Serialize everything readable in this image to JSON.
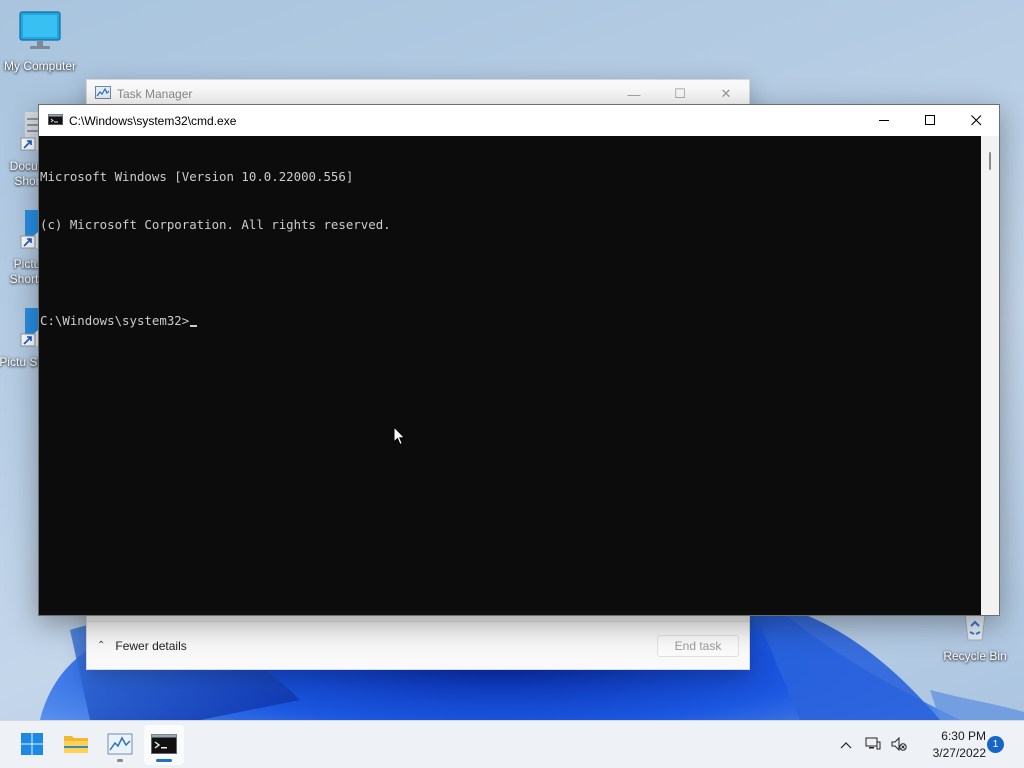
{
  "desktop": {
    "icons": [
      {
        "label": "My Computer",
        "icon": "monitor-icon"
      },
      {
        "label": "Docun Shor",
        "icon": "documents-shortcut-icon"
      },
      {
        "label": "Pictu Shortc",
        "icon": "pictures-shortcut-icon"
      },
      {
        "label": "Pictu Shor",
        "icon": "pictures-shortcut-icon"
      },
      {
        "label": "Recycle Bin",
        "icon": "recycle-bin-icon"
      }
    ]
  },
  "task_manager": {
    "title": "Task Manager",
    "fewer_details": "Fewer details",
    "end_task": "End task"
  },
  "cmd": {
    "title": "C:\\Windows\\system32\\cmd.exe",
    "lines": [
      "Microsoft Windows [Version 10.0.22000.556]",
      "(c) Microsoft Corporation. All rights reserved.",
      "",
      "C:\\Windows\\system32>"
    ]
  },
  "taskbar": {
    "clock_time": "6:30 PM",
    "clock_date": "3/27/2022",
    "notification_count": "1",
    "apps": [
      "start-icon",
      "file-explorer-icon",
      "task-manager-icon",
      "command-prompt-icon"
    ]
  },
  "colors": {
    "accent": "#1a6fd1",
    "console_bg": "#0c0c0c",
    "console_text": "#cccccc"
  }
}
